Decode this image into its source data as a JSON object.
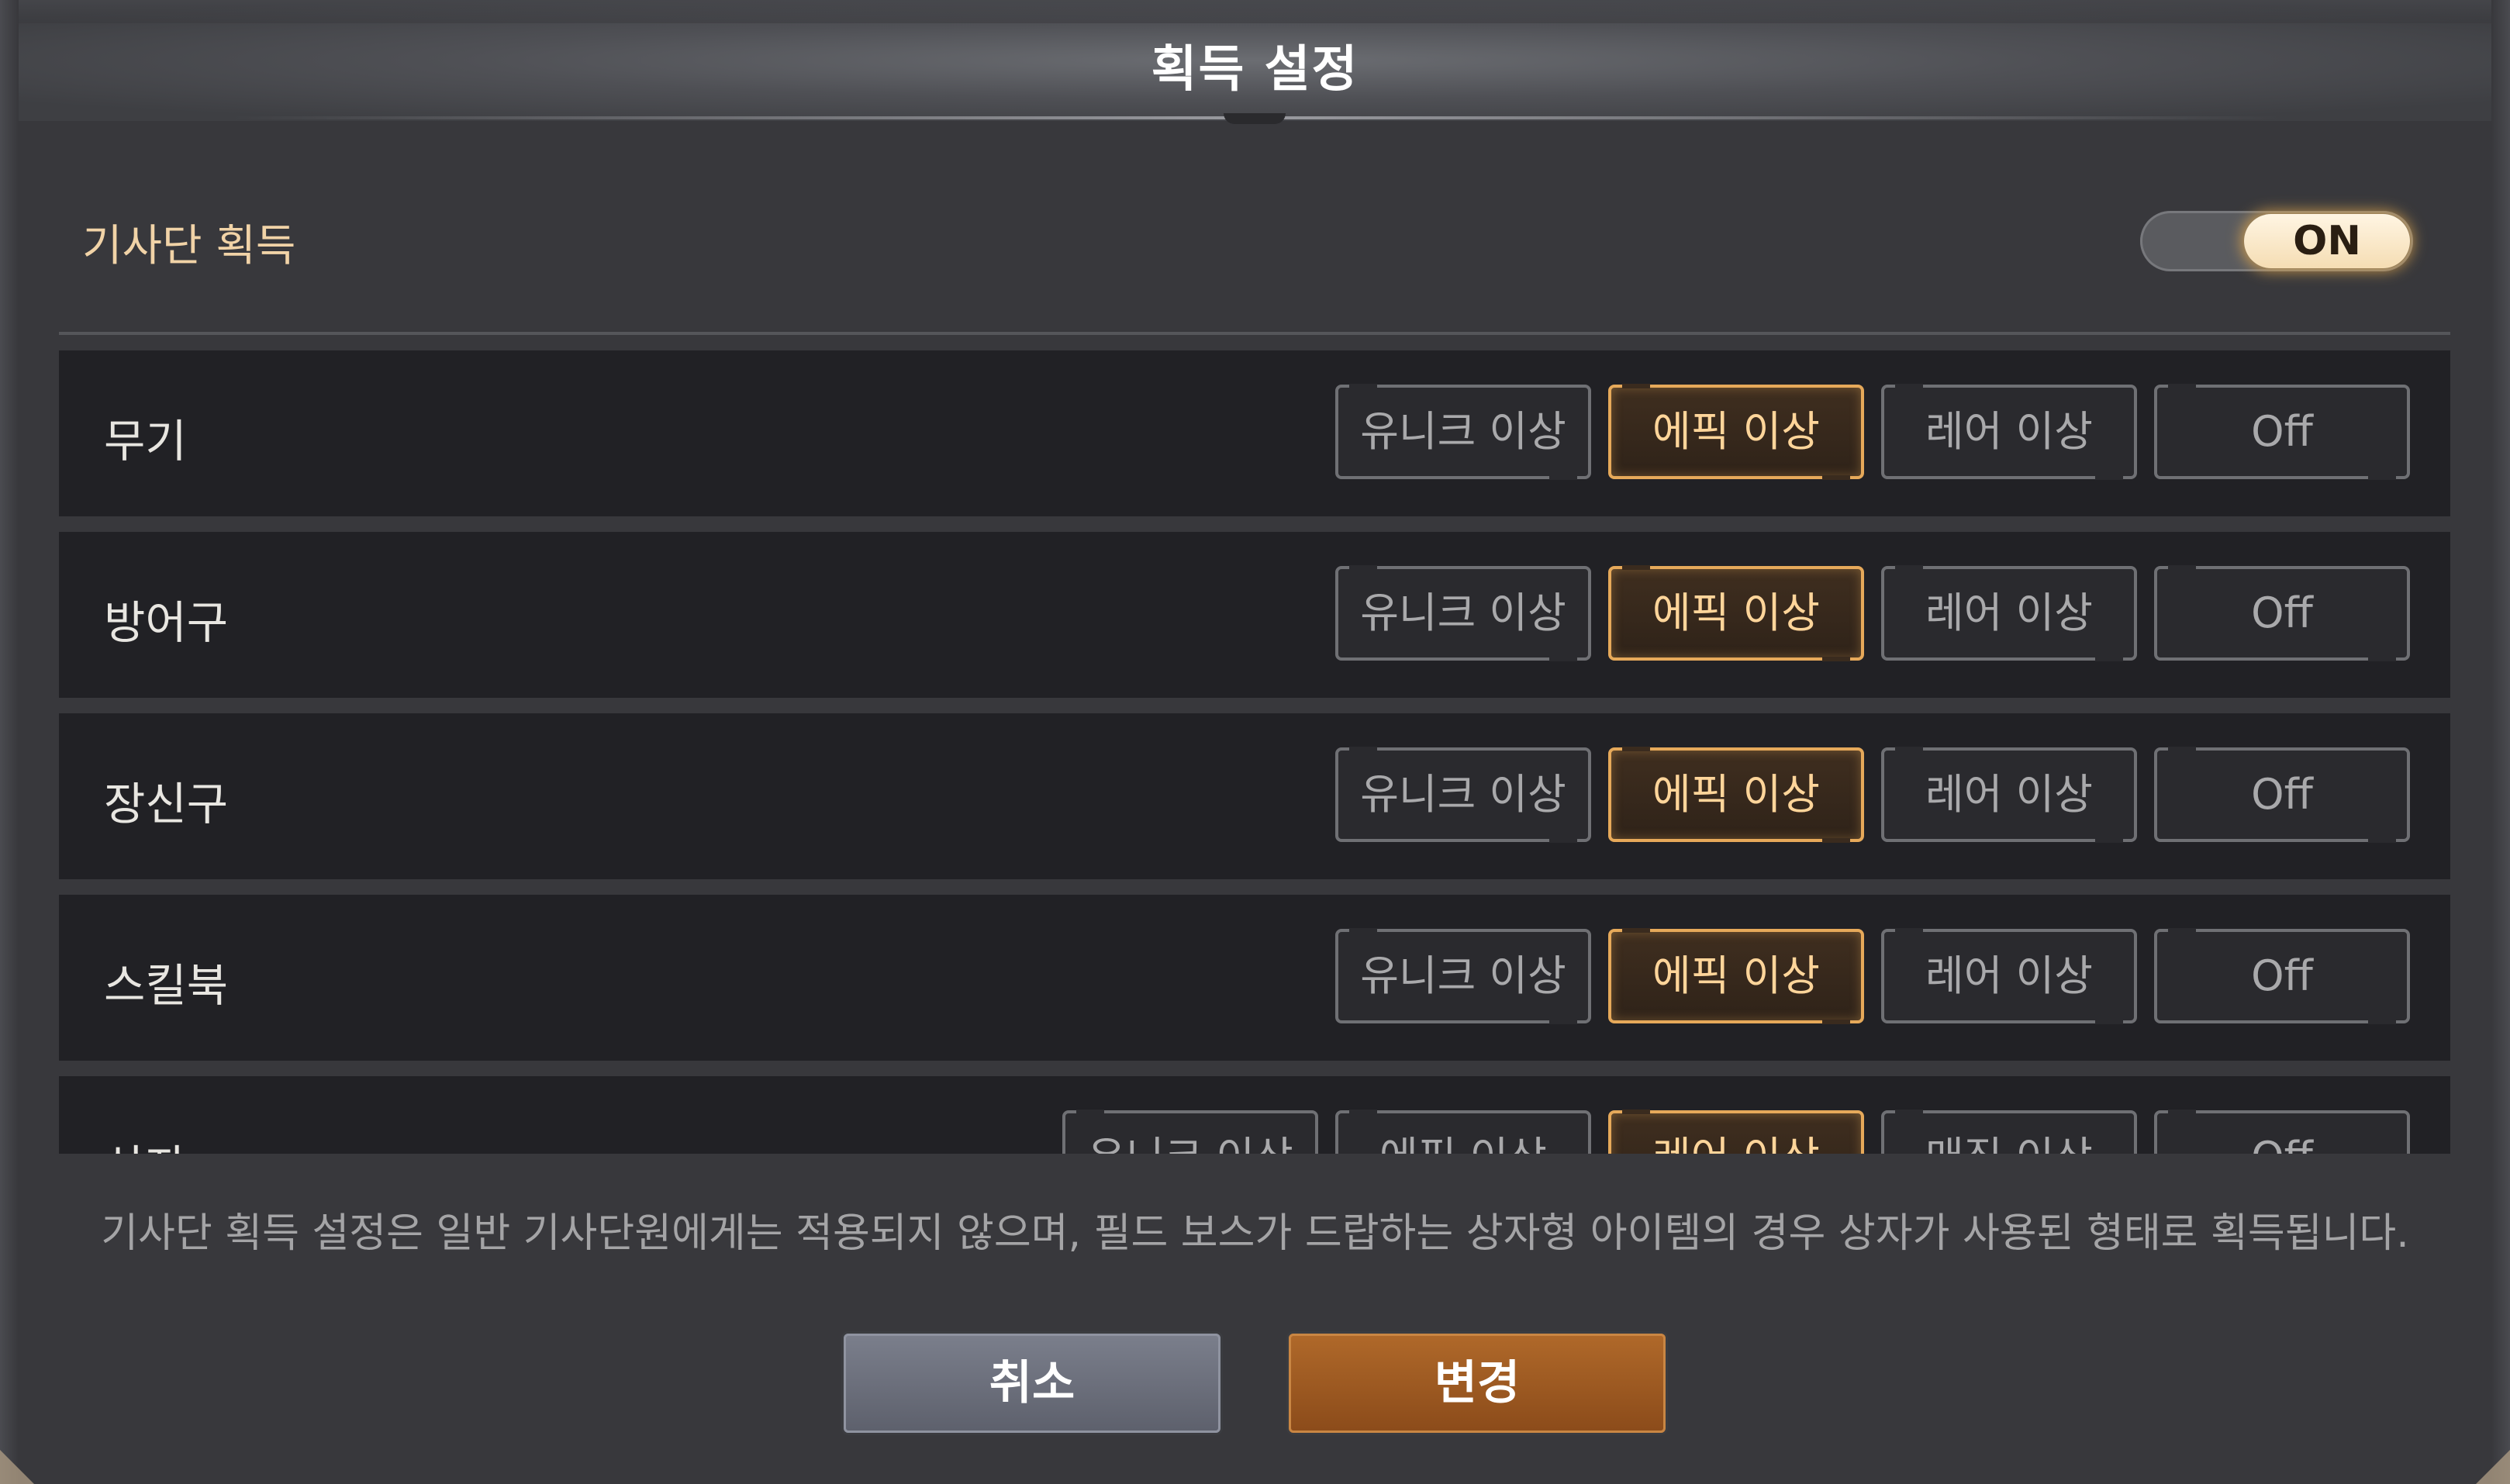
{
  "title": "획득 설정",
  "master": {
    "label": "기사단 획득",
    "toggle_state": "ON"
  },
  "categories": [
    {
      "label": "무기",
      "options": [
        "유니크 이상",
        "에픽 이상",
        "레어 이상",
        "Off"
      ],
      "selected": "에픽 이상"
    },
    {
      "label": "방어구",
      "options": [
        "유니크 이상",
        "에픽 이상",
        "레어 이상",
        "Off"
      ],
      "selected": "에픽 이상"
    },
    {
      "label": "장신구",
      "options": [
        "유니크 이상",
        "에픽 이상",
        "레어 이상",
        "Off"
      ],
      "selected": "에픽 이상"
    },
    {
      "label": "스킬북",
      "options": [
        "유니크 이상",
        "에픽 이상",
        "레어 이상",
        "Off"
      ],
      "selected": "에픽 이상"
    },
    {
      "label": "상자",
      "options": [
        "유니크 이상",
        "에픽 이상",
        "레어 이상",
        "매직 이상",
        "Off"
      ],
      "selected": "레어 이상"
    }
  ],
  "notice": "기사단 획득 설정은 일반 기사단원에게는 적용되지 않으며, 필드 보스가 드랍하는 상자형 아이템의 경우 상자가 사용된 형태로 획득됩니다.",
  "buttons": {
    "cancel": "취소",
    "confirm": "변경"
  },
  "colors": {
    "accent": "#e6a95a",
    "label_gold": "#f1d3a7",
    "confirm_button": "#9b5821"
  }
}
